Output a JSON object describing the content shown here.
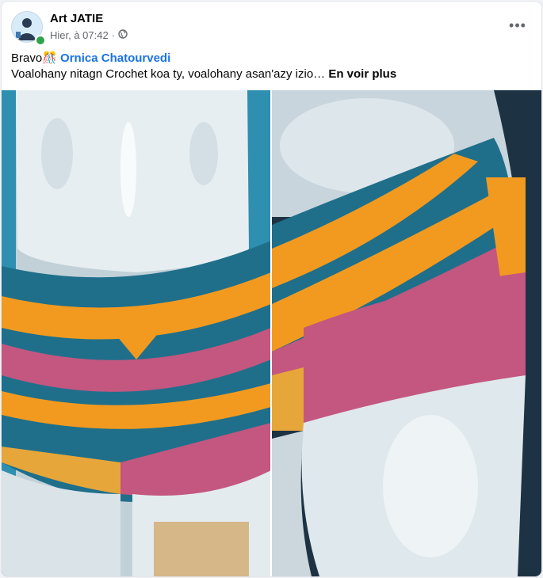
{
  "post": {
    "author": "Art JATIE",
    "time": "Hier, à 07:42",
    "separator": "·",
    "audience_icon": "globe-icon",
    "more_icon": "more-options-icon",
    "text_prefix": "Bravo",
    "emoji": "🎊",
    "mention": "Ornica Chatourvedi",
    "text_line2": "Voalohany nitagn Crochet koa ty, voalohany asan'azy izio…",
    "see_more": "En voir plus"
  },
  "colors": {
    "accent": "#1b74e4",
    "online": "#31a24c",
    "crochet_orange": "#f29a1f",
    "crochet_teal": "#1f6f8b",
    "crochet_pink": "#c3577f",
    "crochet_mustard": "#e7a63a"
  }
}
